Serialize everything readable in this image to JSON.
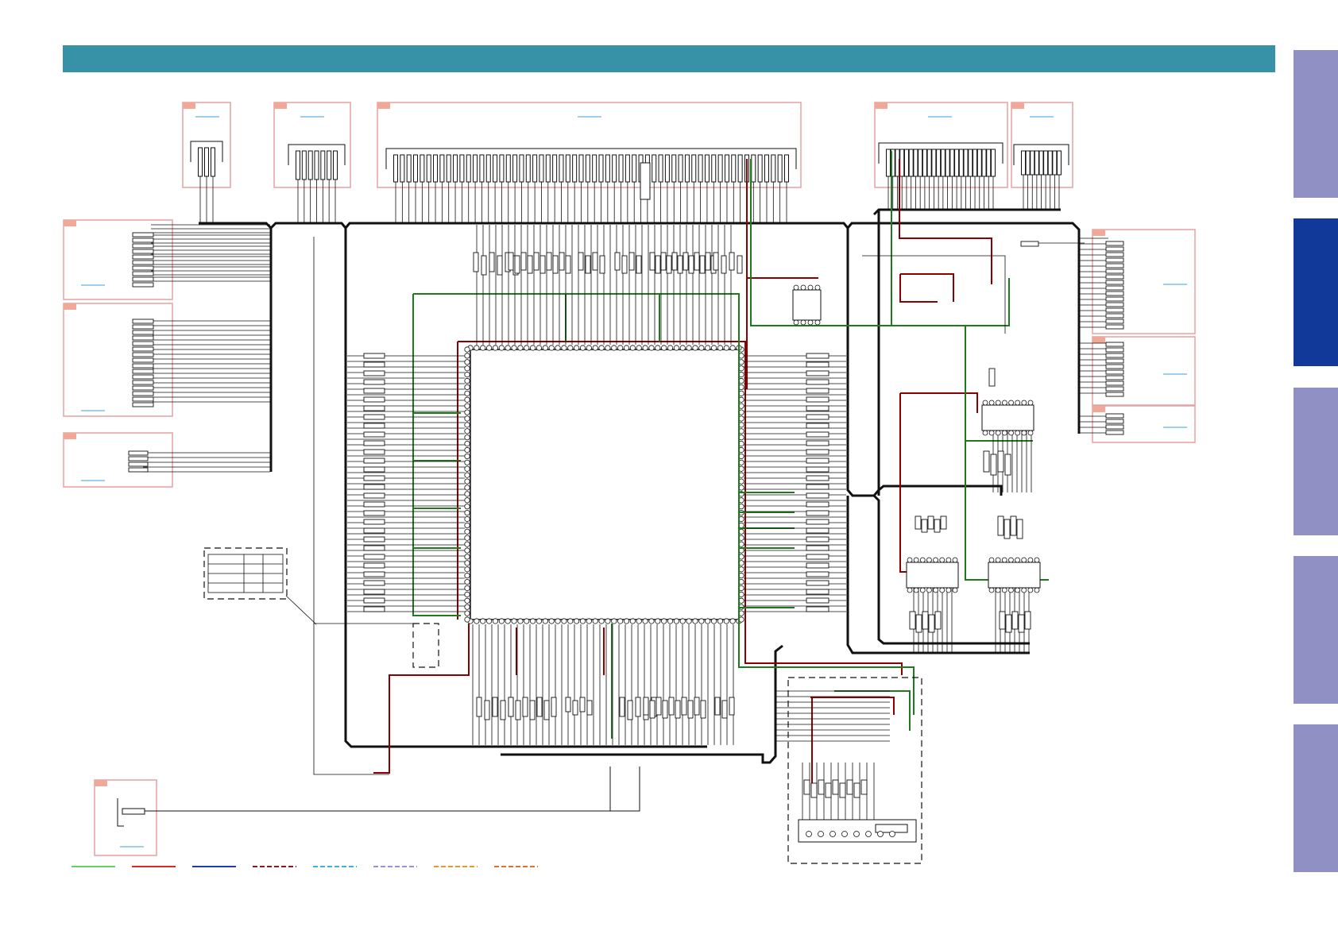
{
  "colors": {
    "header": "#3791a7",
    "tab_inactive": "#9090c4",
    "tab_active": "#11399a",
    "block_border": "#e6a0a0",
    "block_tag": "#f0a898",
    "link": "#3aa0d8",
    "wire": "#111111",
    "power_red": "#8b0000",
    "ground_green": "#1d7a1d"
  },
  "header": {
    "label": ""
  },
  "side_tabs": [
    {
      "name": "side-tab-1",
      "active": false
    },
    {
      "name": "side-tab-2",
      "active": true
    },
    {
      "name": "side-tab-3",
      "active": false
    },
    {
      "name": "side-tab-4",
      "active": false
    },
    {
      "name": "side-tab-5",
      "active": false
    }
  ],
  "blocks": [
    {
      "name": "connector-block-top-1"
    },
    {
      "name": "connector-block-top-2"
    },
    {
      "name": "connector-block-top-main"
    },
    {
      "name": "connector-block-top-right-1"
    },
    {
      "name": "connector-block-top-right-2"
    },
    {
      "name": "connector-block-left-1"
    },
    {
      "name": "connector-block-left-2"
    },
    {
      "name": "connector-block-left-3"
    },
    {
      "name": "connector-block-bottom-left"
    },
    {
      "name": "connector-block-right-1"
    },
    {
      "name": "connector-block-right-2"
    },
    {
      "name": "connector-block-right-3"
    }
  ],
  "legend": [
    {
      "name": "legend-line-green",
      "color": "#5fd35f",
      "style": "solid"
    },
    {
      "name": "legend-line-red",
      "color": "#d42a2a",
      "style": "solid"
    },
    {
      "name": "legend-line-blue",
      "color": "#1e3fa8",
      "style": "solid"
    },
    {
      "name": "legend-line-darkred",
      "color": "#8b1a1a",
      "style": "dashed"
    },
    {
      "name": "legend-line-cyan",
      "color": "#3bb0e0",
      "style": "dashed"
    },
    {
      "name": "legend-line-lavender",
      "color": "#9a8fd8",
      "style": "dashed"
    },
    {
      "name": "legend-line-orange",
      "color": "#e39a2a",
      "style": "dashed"
    },
    {
      "name": "legend-line-darkorange",
      "color": "#e0702a",
      "style": "dashed"
    }
  ]
}
